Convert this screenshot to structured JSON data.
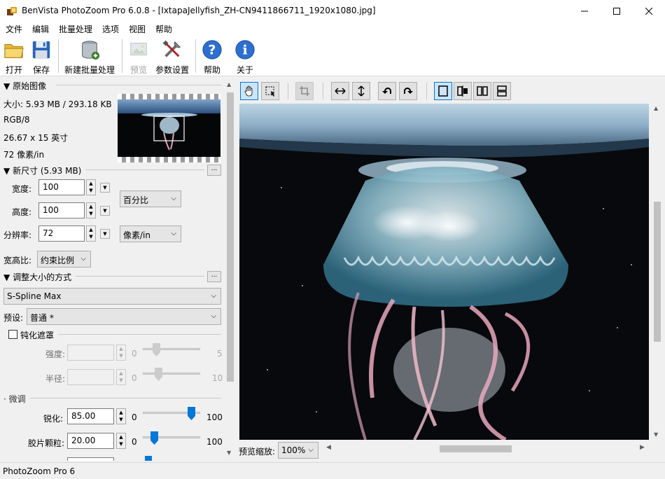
{
  "window": {
    "title": "BenVista PhotoZoom Pro 6.0.8 - [IxtapaJellyfish_ZH-CN9411866711_1920x1080.jpg]"
  },
  "menu": [
    "文件",
    "编辑",
    "批量处理",
    "选项",
    "视图",
    "帮助"
  ],
  "toolbar": {
    "open": "打开",
    "save": "保存",
    "new_batch": "新建批量处理",
    "preview": "预览",
    "settings": "参数设置",
    "help": "帮助",
    "about": "关于"
  },
  "original": {
    "header": "原始图像",
    "size": "大小: 5.93 MB / 293.18 KB",
    "mode": "RGB/8",
    "dimensions": "26.67 x 15 英寸",
    "resolution": "72 像素/in"
  },
  "newsize": {
    "header": "新尺寸 (5.93 MB)",
    "width_label": "宽度:",
    "width": "100",
    "height_label": "高度:",
    "height": "100",
    "res_label": "分辨率:",
    "res": "72",
    "unit": "百分比",
    "res_unit": "像素/in",
    "aspect_label": "宽高比:",
    "aspect": "约束比例"
  },
  "resize": {
    "header": "调整大小的方式",
    "method": "S-Spline Max",
    "preset_label": "预设:",
    "preset": "普通 *"
  },
  "unsharp": {
    "label": "钝化遮罩",
    "strength_label": "强度:",
    "strength_min": "0",
    "strength_max": "5",
    "radius_label": "半径:",
    "radius_min": "0",
    "radius_max": "10"
  },
  "finetune": {
    "label": "微调",
    "sharpen_label": "锐化:",
    "sharpen": "85.00",
    "sharpen_min": "0",
    "sharpen_max": "100",
    "sharpen_level": 0.85,
    "grain_label": "胶片颗粒:",
    "grain": "20.00",
    "grain_min": "0",
    "grain_max": "100",
    "grain_level": 0.2
  },
  "preview": {
    "zoom_label": "预览缩放:",
    "zoom": "100%"
  },
  "status": "PhotoZoom Pro 6",
  "colors": {
    "accent": "#0078d7",
    "selection": "#cce4f7"
  }
}
